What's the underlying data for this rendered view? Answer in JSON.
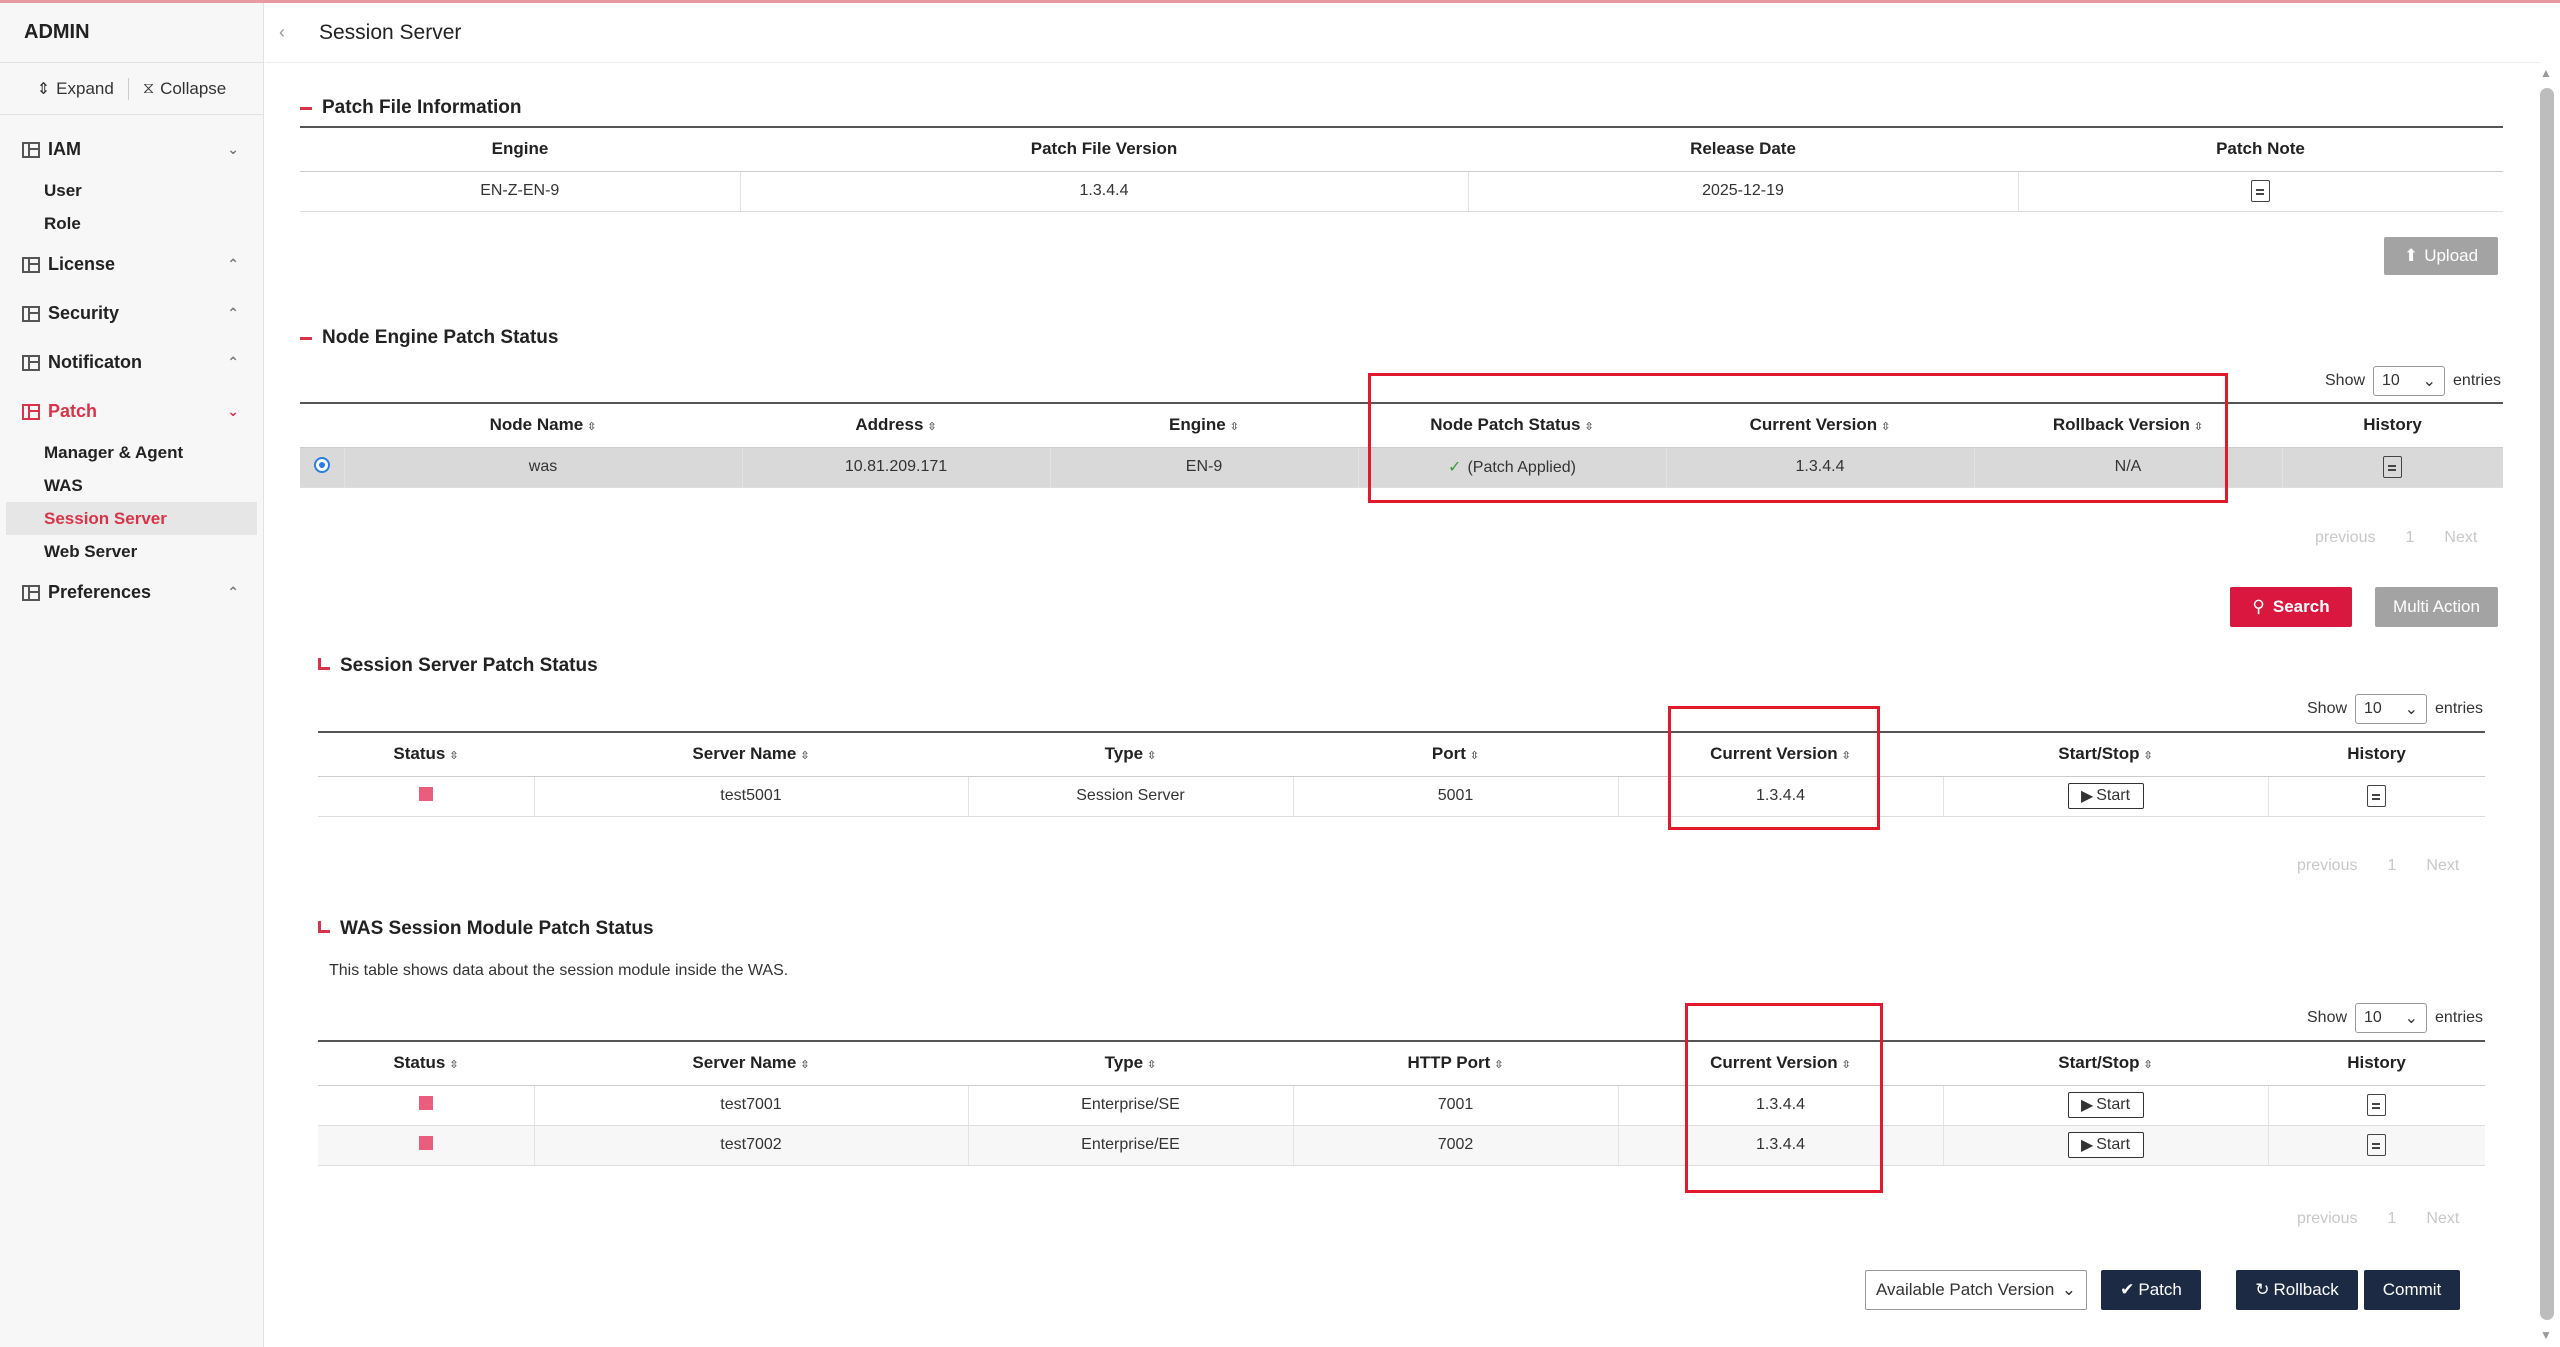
{
  "sidebar": {
    "title": "ADMIN",
    "expand_label": "Expand",
    "collapse_label": "Collapse",
    "groups": [
      {
        "label": "IAM",
        "chevron": "⌄",
        "items": [
          "User",
          "Role"
        ]
      },
      {
        "label": "License",
        "chevron": "⌃"
      },
      {
        "label": "Security",
        "chevron": "⌃"
      },
      {
        "label": "Notificaton",
        "chevron": "⌃"
      },
      {
        "label": "Patch",
        "chevron": "⌄",
        "items": [
          "Manager & Agent",
          "WAS",
          "Session Server",
          "Web Server"
        ]
      },
      {
        "label": "Preferences",
        "chevron": "⌃"
      }
    ],
    "accent_color": "#d9334a"
  },
  "header": {
    "title": "Session Server"
  },
  "patch_file": {
    "title": "Patch File Information",
    "columns": [
      "Engine",
      "Patch File Version",
      "Release Date",
      "Patch Note"
    ],
    "row": {
      "engine": "EN-Z-EN-9",
      "version": "1.3.4.4",
      "release_date": "2025-12-19"
    },
    "upload_label": "Upload"
  },
  "node_engine": {
    "title": "Node Engine Patch Status",
    "show_label": "Show",
    "show_value": "10",
    "entries_label": "entries",
    "columns": [
      "Node Name",
      "Address",
      "Engine",
      "Node Patch Status",
      "Current Version",
      "Rollback Version",
      "History"
    ],
    "row": {
      "name": "was",
      "address": "10.81.209.171",
      "engine": "EN-9",
      "status": "(Patch Applied)",
      "current_version": "1.3.4.4",
      "rollback_version": "N/A"
    },
    "pager": {
      "previous": "previous",
      "page": "1",
      "next": "Next"
    },
    "search_label": "Search",
    "multi_action_label": "Multi Action"
  },
  "session_server": {
    "title": "Session Server Patch Status",
    "show_label": "Show",
    "show_value": "10",
    "entries_label": "entries",
    "columns": [
      "Status",
      "Server Name",
      "Type",
      "Port",
      "Current Version",
      "Start/Stop",
      "History"
    ],
    "rows": [
      {
        "name": "test5001",
        "type": "Session Server",
        "port": "5001",
        "version": "1.3.4.4",
        "action": "Start"
      }
    ],
    "pager": {
      "previous": "previous",
      "page": "1",
      "next": "Next"
    }
  },
  "was_module": {
    "title": "WAS Session Module Patch Status",
    "description": "This table shows data about the session module inside the WAS.",
    "show_label": "Show",
    "show_value": "10",
    "entries_label": "entries",
    "columns": [
      "Status",
      "Server Name",
      "Type",
      "HTTP Port",
      "Current Version",
      "Start/Stop",
      "History"
    ],
    "rows": [
      {
        "name": "test7001",
        "type": "Enterprise/SE",
        "port": "7001",
        "version": "1.3.4.4",
        "action": "Start"
      },
      {
        "name": "test7002",
        "type": "Enterprise/EE",
        "port": "7002",
        "version": "1.3.4.4",
        "action": "Start"
      }
    ],
    "pager": {
      "previous": "previous",
      "page": "1",
      "next": "Next"
    }
  },
  "footer": {
    "version_select": "Available Patch Version",
    "patch_label": "Patch",
    "rollback_label": "Rollback",
    "commit_label": "Commit"
  },
  "colors": {
    "accent": "#d9173f",
    "navy": "#1c2a44",
    "highlight_box": "#e0192c",
    "status_square": "#ea5d7c"
  }
}
